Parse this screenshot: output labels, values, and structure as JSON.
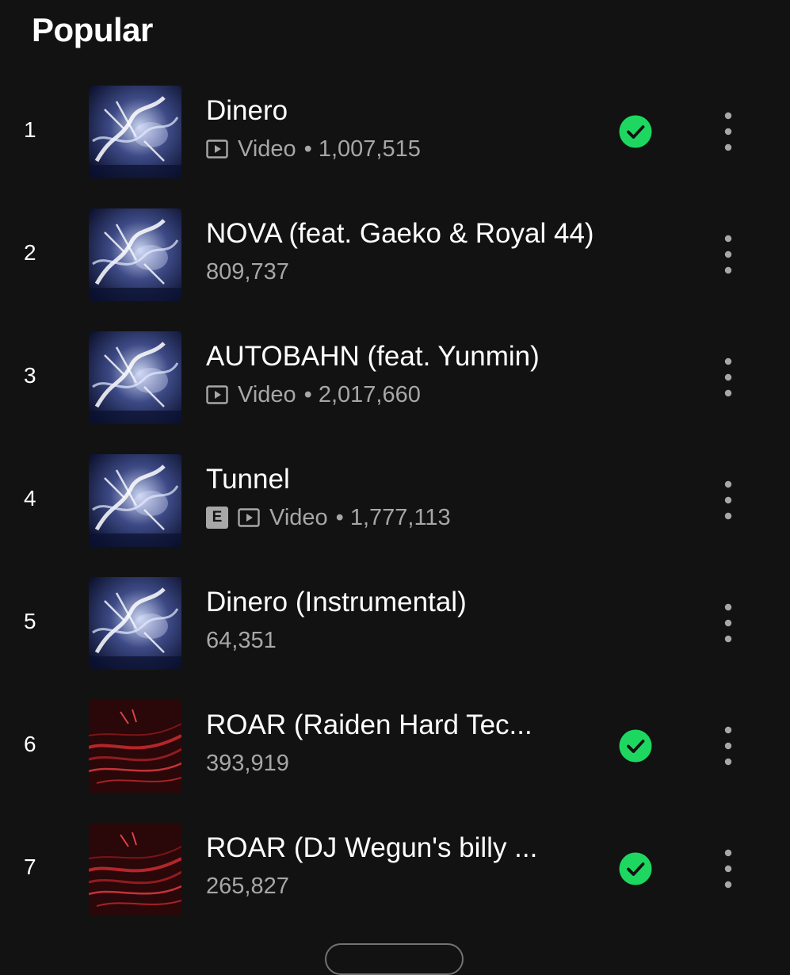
{
  "section": {
    "heading": "Popular"
  },
  "colors": {
    "background": "#121212",
    "primary_text": "#ffffff",
    "secondary_text": "#a7a7a7",
    "saved_green": "#1ed760"
  },
  "icons": {
    "video": "video-play-icon",
    "saved": "saved-check-icon",
    "more": "more-options-vertical-icon"
  },
  "tracks": [
    {
      "rank": "1",
      "title": "Dinero",
      "explicit": false,
      "video": true,
      "video_label": "Video",
      "plays": "1,007,515",
      "saved": true,
      "cover": "blue-white"
    },
    {
      "rank": "2",
      "title": "NOVA (feat. Gaeko & Royal 44)",
      "explicit": false,
      "video": false,
      "video_label": "",
      "plays": "809,737",
      "saved": false,
      "cover": "blue-white"
    },
    {
      "rank": "3",
      "title": "AUTOBAHN (feat. Yunmin)",
      "explicit": false,
      "video": true,
      "video_label": "Video",
      "plays": "2,017,660",
      "saved": false,
      "cover": "blue-white"
    },
    {
      "rank": "4",
      "title": "Tunnel",
      "explicit": true,
      "explicit_label": "E",
      "video": true,
      "video_label": "Video",
      "plays": "1,777,113",
      "saved": false,
      "cover": "blue-white"
    },
    {
      "rank": "5",
      "title": "Dinero (Instrumental)",
      "explicit": false,
      "video": false,
      "video_label": "",
      "plays": "64,351",
      "saved": false,
      "cover": "blue-white"
    },
    {
      "rank": "6",
      "title": "ROAR (Raiden Hard Tec...",
      "explicit": false,
      "video": false,
      "video_label": "",
      "plays": "393,919",
      "saved": true,
      "cover": "red"
    },
    {
      "rank": "7",
      "title": "ROAR (DJ Wegun's billy ...",
      "explicit": false,
      "video": false,
      "video_label": "",
      "plays": "265,827",
      "saved": true,
      "cover": "red"
    }
  ]
}
